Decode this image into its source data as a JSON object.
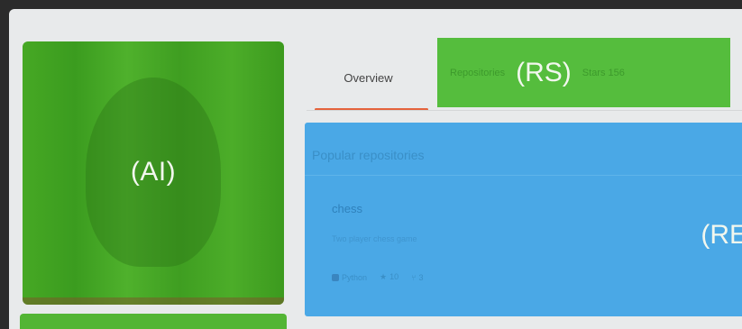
{
  "avatar": {
    "annotation": "(AI)"
  },
  "tabs": {
    "overview_label": "Overview",
    "repositories_label": "Repositories",
    "rs_annotation": "(RS)",
    "stars_label": "Stars 156"
  },
  "repos": {
    "heading": "Popular repositories",
    "annotation": "(RE",
    "items": [
      {
        "name": "chess",
        "description": "Two player chess game",
        "language": "Python",
        "stars": "10",
        "forks": "3"
      }
    ]
  },
  "icons": {
    "star": "star-icon",
    "fork": "fork-icon",
    "language": "language-dot-icon"
  },
  "colors": {
    "annotation_green": "#55bd3d",
    "annotation_blue": "#4aa8e6",
    "tab_underline": "#e4633c"
  }
}
